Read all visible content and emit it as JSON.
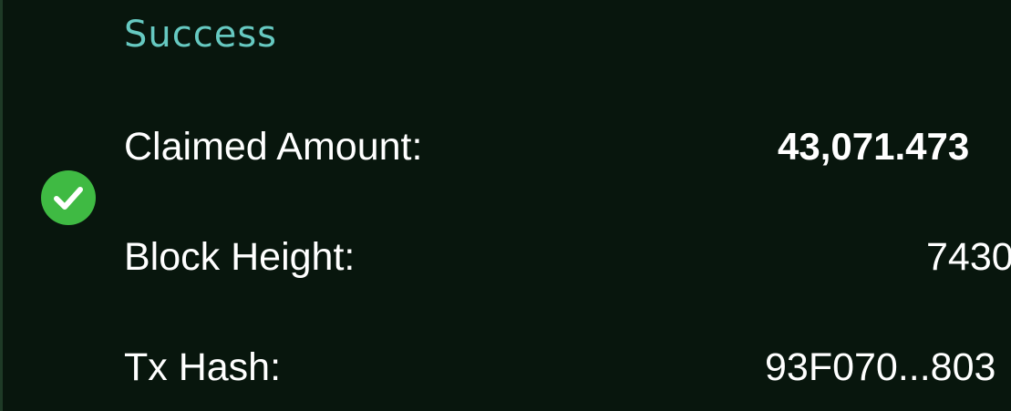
{
  "status": {
    "title": "Success",
    "icon": "check-circle-icon",
    "title_color": "#66c9c1",
    "icon_color": "#3fba43"
  },
  "details": [
    {
      "label": "Claimed Amount:",
      "value": "43,071.473"
    },
    {
      "label": "Block Height:",
      "value": "7430"
    },
    {
      "label": "Tx Hash:",
      "value": "93F070...803"
    }
  ],
  "theme": {
    "background": "#08160d",
    "text": "#ffffff"
  }
}
